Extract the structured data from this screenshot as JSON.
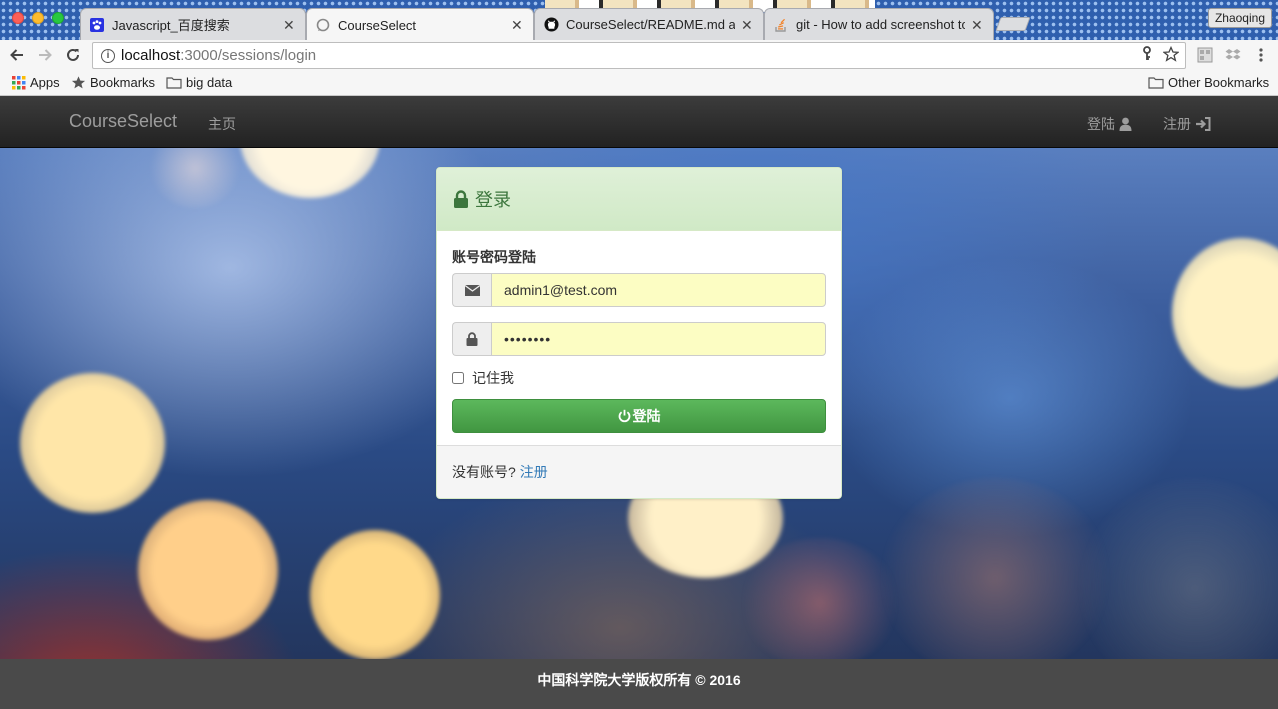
{
  "browser": {
    "tabs": [
      {
        "title": "Javascript_百度搜索",
        "favicon": "paw-icon",
        "active": false
      },
      {
        "title": "CourseSelect",
        "favicon": "loading-icon",
        "active": true
      },
      {
        "title": "CourseSelect/README.md at",
        "favicon": "github-icon",
        "active": false
      },
      {
        "title": "git - How to add screenshot to",
        "favicon": "stackoverflow-icon",
        "active": false
      }
    ],
    "tab_close": "✕",
    "profile_name": "Zhaoqing",
    "url_host": "localhost",
    "url_path": ":3000/sessions/login",
    "bookmarks": {
      "apps": "Apps",
      "bookmarks": "Bookmarks",
      "folder": "big data",
      "other": "Other Bookmarks"
    }
  },
  "navbar": {
    "brand": "CourseSelect",
    "home": "主页",
    "login": "登陆",
    "register": "注册"
  },
  "login_panel": {
    "title": "登录",
    "section_label": "账号密码登陆",
    "email_value": "admin1@test.com",
    "password_mask": "••••••••",
    "remember_label": "记住我",
    "submit_label": "登陆",
    "footer_prompt": "没有账号?",
    "footer_link": "注册"
  },
  "footer": {
    "text": "中国科学院大学版权所有 © 2016"
  },
  "colors": {
    "navbar": "#222222",
    "panel_heading": "#dff0d8",
    "panel_title": "#3c763d",
    "input_autofill": "#fcfdc3",
    "button_success": "#5cb85c",
    "link": "#337ab7",
    "footer": "#4a4a4a"
  }
}
